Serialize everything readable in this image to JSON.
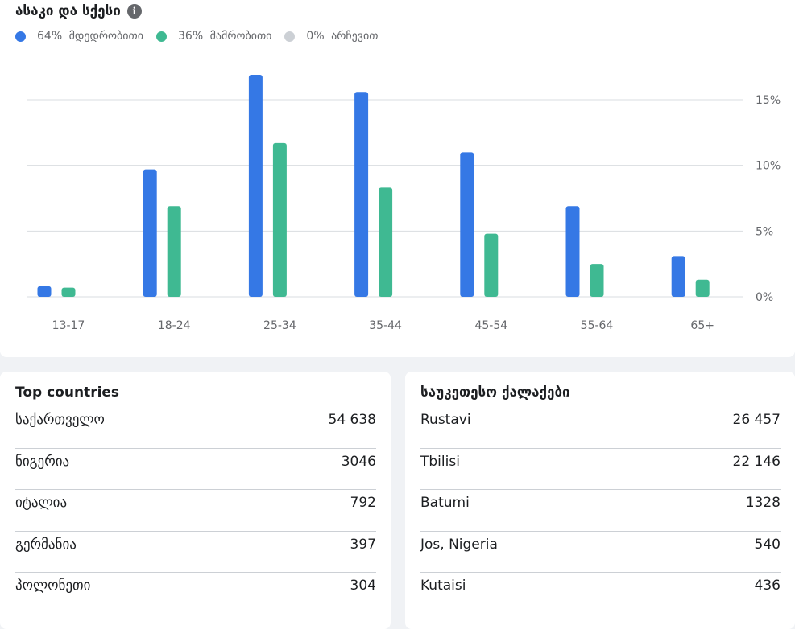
{
  "age_gender": {
    "title": "ასაკი და სქესი",
    "legend": [
      {
        "value": "64%",
        "label": "მდედრობითი",
        "color": "#3578e5"
      },
      {
        "value": "36%",
        "label": "მამრობითი",
        "color": "#3fb992"
      },
      {
        "value": "0%",
        "label": "არჩევით",
        "color": "#ccd0d5"
      }
    ]
  },
  "chart_data": {
    "type": "bar",
    "categories": [
      "13-17",
      "18-24",
      "25-34",
      "35-44",
      "45-54",
      "55-64",
      "65+"
    ],
    "series": [
      {
        "name": "მდედრობითი",
        "color": "#3578e5",
        "values": [
          0.8,
          9.7,
          16.9,
          15.6,
          11.0,
          6.9,
          3.1
        ]
      },
      {
        "name": "მამრობითი",
        "color": "#3fb992",
        "values": [
          0.7,
          6.9,
          11.7,
          8.3,
          4.8,
          2.5,
          1.3
        ]
      }
    ],
    "yticks": [
      "0%",
      "5%",
      "10%",
      "15%"
    ],
    "ylim": [
      0,
      15
    ],
    "grid": true,
    "yaxis_position": "right"
  },
  "countries": {
    "title": "Top countries",
    "rows": [
      {
        "name": "საქართველო",
        "value": "54 638"
      },
      {
        "name": "ნიგერია",
        "value": "3046"
      },
      {
        "name": "იტალია",
        "value": "792"
      },
      {
        "name": "გერმანია",
        "value": "397"
      },
      {
        "name": "პოლონეთი",
        "value": "304"
      }
    ]
  },
  "cities": {
    "title": "საუკეთესო ქალაქები",
    "rows": [
      {
        "name": "Rustavi",
        "value": "26 457"
      },
      {
        "name": "Tbilisi",
        "value": "22 146"
      },
      {
        "name": "Batumi",
        "value": "1328"
      },
      {
        "name": "Jos, Nigeria",
        "value": "540"
      },
      {
        "name": "Kutaisi",
        "value": "436"
      }
    ]
  }
}
